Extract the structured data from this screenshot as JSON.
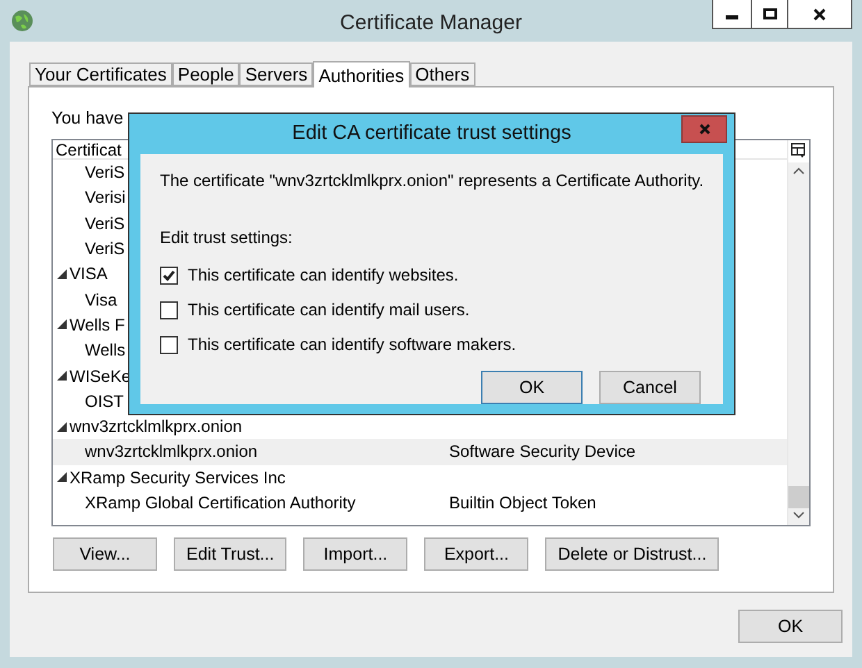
{
  "window": {
    "title": "Certificate Manager"
  },
  "tabs": [
    {
      "label": "Your Certificates",
      "selected": false
    },
    {
      "label": "People",
      "selected": false
    },
    {
      "label": "Servers",
      "selected": false
    },
    {
      "label": "Authorities",
      "selected": true
    },
    {
      "label": "Others",
      "selected": false
    }
  ],
  "intro": "You have",
  "tree": {
    "columns": [
      "Certificat"
    ],
    "items": [
      {
        "children": [
          {
            "name": "VeriS",
            "selected": false
          },
          {
            "name": "Verisi",
            "selected": false
          },
          {
            "name": "VeriS",
            "selected": false
          },
          {
            "name": "VeriS",
            "selected": false
          }
        ]
      },
      {
        "name": "VISA",
        "expanded": true,
        "children": [
          {
            "name": "Visa",
            "selected": false
          }
        ]
      },
      {
        "name": "Wells F",
        "expanded": true,
        "children": [
          {
            "name": "Wells",
            "selected": false
          }
        ]
      },
      {
        "name": "WISeKe",
        "expanded": true,
        "children": [
          {
            "name": "OIST",
            "selected": false
          }
        ]
      },
      {
        "name": "wnv3zrtcklmlkprx.onion",
        "expanded": true,
        "children": [
          {
            "name": "wnv3zrtcklmlkprx.onion",
            "device": "Software Security Device",
            "selected": true
          }
        ]
      },
      {
        "name": "XRamp Security Services Inc",
        "expanded": true,
        "children": [
          {
            "name": "XRamp Global Certification Authority",
            "device": "Builtin Object Token",
            "selected": false
          }
        ]
      }
    ]
  },
  "buttons": [
    "View...",
    "Edit Trust...",
    "Import...",
    "Export...",
    "Delete or Distrust..."
  ],
  "ok_button": "OK",
  "dialog": {
    "title": "Edit CA certificate trust settings",
    "message": "The certificate \"wnv3zrtcklmlkprx.onion\" represents a Certificate Authority.",
    "section_label": "Edit trust settings:",
    "options": [
      {
        "label": "This certificate can identify websites.",
        "checked": true
      },
      {
        "label": "This certificate can identify mail users.",
        "checked": false
      },
      {
        "label": "This certificate can identify software makers.",
        "checked": false
      }
    ],
    "buttons": [
      {
        "label": "OK",
        "focused": true
      },
      {
        "label": "Cancel",
        "focused": false
      }
    ]
  }
}
